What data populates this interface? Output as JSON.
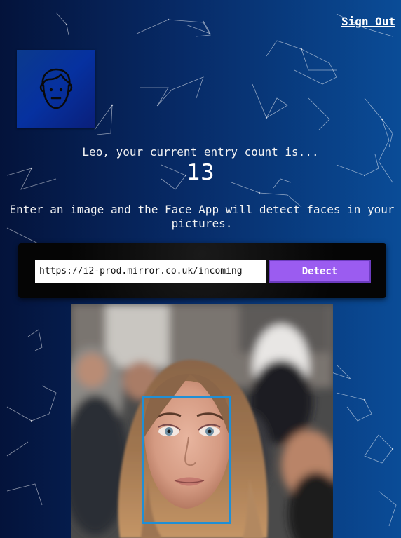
{
  "header": {
    "sign_out_label": "Sign Out"
  },
  "logo": {
    "icon": "face-outline-icon"
  },
  "rank": {
    "message": "Leo, your current entry count is...",
    "count": "13"
  },
  "intro": {
    "text": "Enter an image and the Face App will detect faces in your pictures."
  },
  "form": {
    "image_url": "https://i2-prod.mirror.co.uk/incoming",
    "detect_label": "Detect"
  },
  "result": {
    "faces_detected": 1,
    "box_color": "#1f8fd6"
  },
  "theme": {
    "background_left": "#04133b",
    "background_right": "#0a4c97",
    "button_color": "#9b5cf0"
  }
}
